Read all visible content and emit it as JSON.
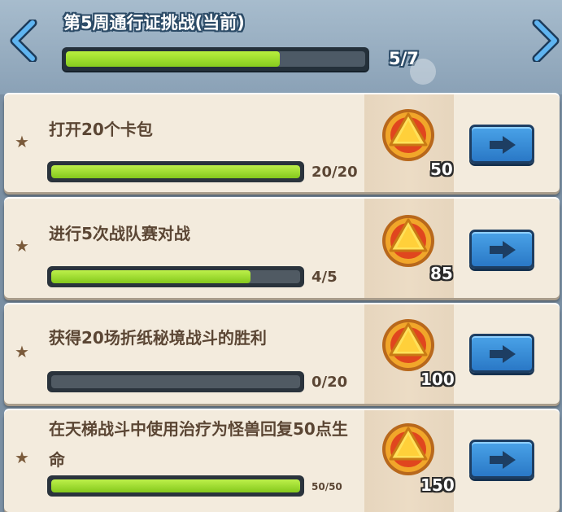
{
  "header": {
    "title": "第5周通行证挑战(当前)",
    "progress_text": "5/7",
    "progress": 0.714
  },
  "tasks": [
    {
      "title": "打开20个卡包",
      "progress_text": "20/20",
      "progress": 1.0,
      "reward": "50"
    },
    {
      "title": "进行5次战队赛对战",
      "progress_text": "4/5",
      "progress": 0.8,
      "reward": "85"
    },
    {
      "title": "获得20场折纸秘境战斗的胜利",
      "progress_text": "0/20",
      "progress": 0.0,
      "reward": "100"
    },
    {
      "title": "在天梯战斗中使用治疗为怪兽回复50点生命",
      "progress_text": "50/50",
      "progress": 1.0,
      "reward": "150"
    }
  ],
  "icons": {
    "nav_prev": "chevron-left-icon",
    "nav_next": "chevron-right-icon",
    "task_marker": "star-icon",
    "reward": "gold-medal-icon",
    "go": "arrow-right-icon"
  },
  "colors": {
    "progress_fill": "#9edc2e",
    "button": "#3a8fd8",
    "card": "#f3ebdd",
    "header": "#98aec2"
  }
}
